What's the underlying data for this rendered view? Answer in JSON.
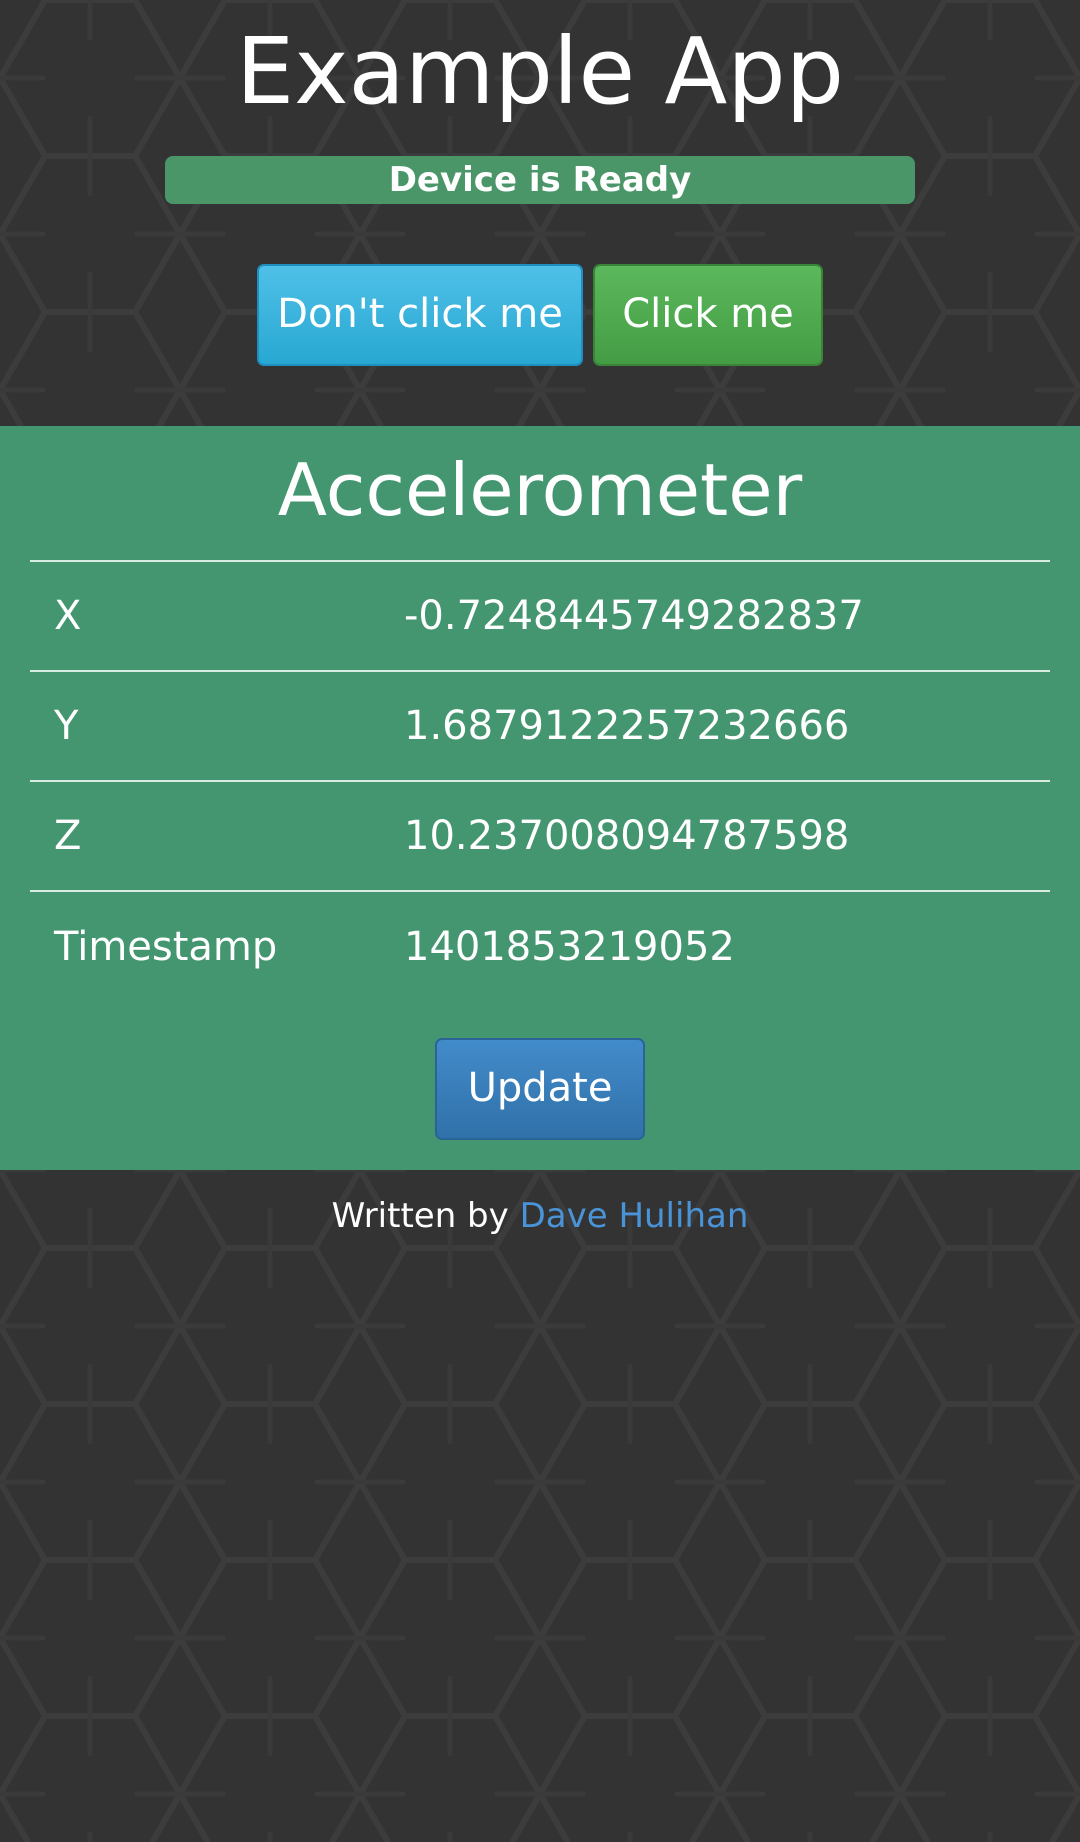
{
  "app": {
    "title": "Example App",
    "status": "Device is Ready"
  },
  "buttons": {
    "dont_click": "Don't click me",
    "click": "Click me"
  },
  "accelerometer": {
    "heading": "Accelerometer",
    "rows": [
      {
        "label": "X",
        "value": "-0.7248445749282837"
      },
      {
        "label": "Y",
        "value": "1.6879122257232666"
      },
      {
        "label": "Z",
        "value": "10.237008094787598"
      },
      {
        "label": "Timestamp",
        "value": "1401853219052"
      }
    ],
    "update_label": "Update"
  },
  "footer": {
    "written_by": "Written by",
    "author": "Dave Hulihan"
  },
  "colors": {
    "background": "#333333",
    "panel": "#43966f",
    "status_bar": "#4a9668",
    "info_button": "#31b0d5",
    "success_button": "#4cae4c",
    "primary_button": "#3276b1",
    "link": "#4a93d6"
  }
}
